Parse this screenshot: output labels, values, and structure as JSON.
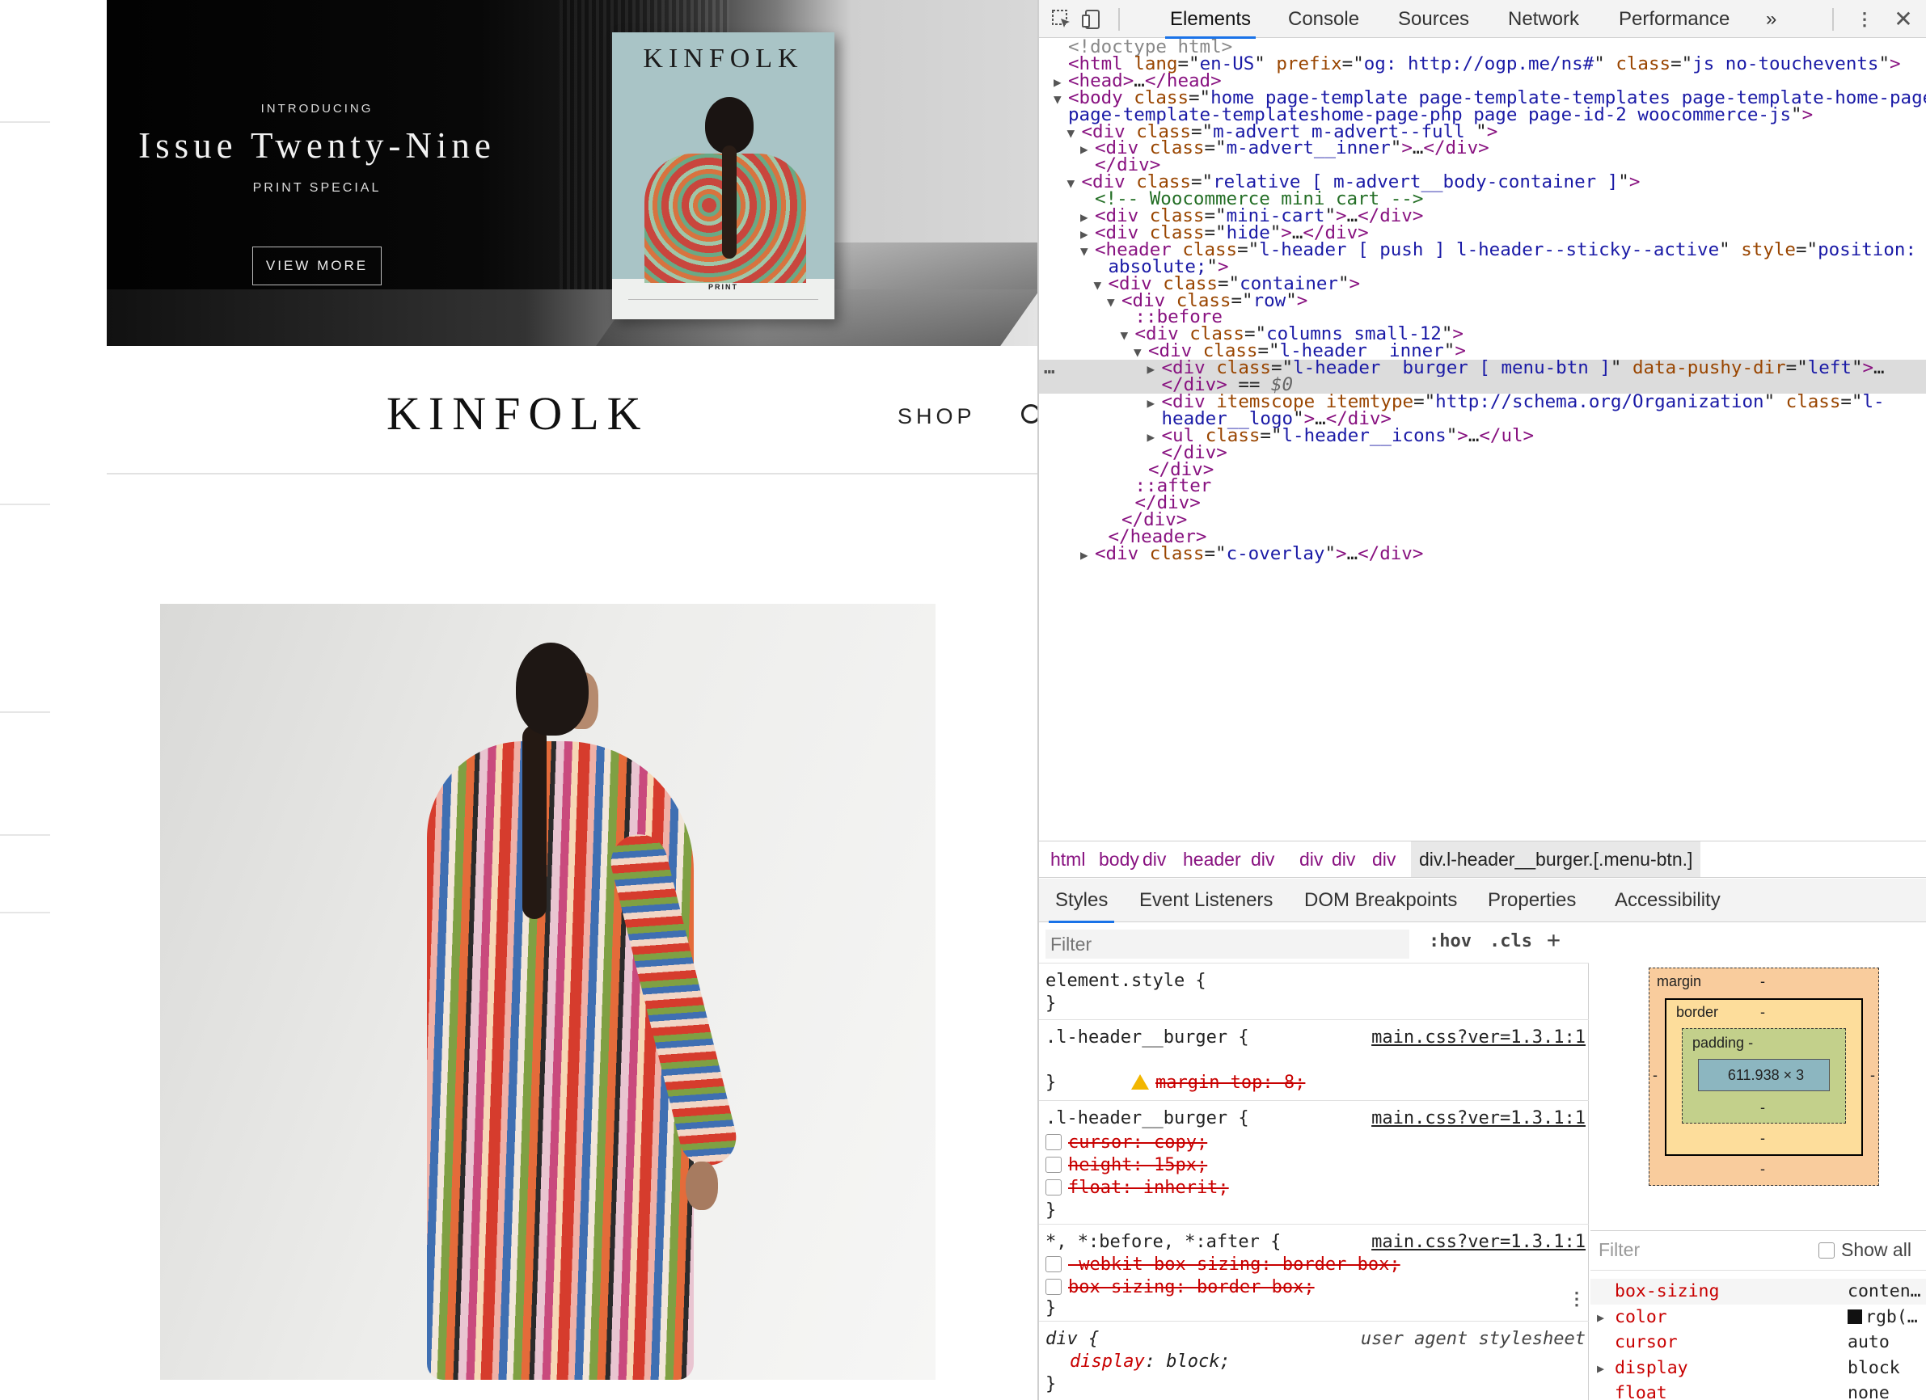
{
  "site": {
    "advert": {
      "intro": "INTRODUCING",
      "title": "Issue Twenty-Nine",
      "subtitle": "PRINT SPECIAL",
      "button": "VIEW MORE",
      "magazine_name": "KINFOLK",
      "magazine_label": "PRINT"
    },
    "header": {
      "logo": "KINFOLK",
      "shop": "SHOP"
    }
  },
  "devtools": {
    "tabs": [
      "Elements",
      "Console",
      "Sources",
      "Network",
      "Performance"
    ],
    "more_tabs": "»",
    "dom_lines": [
      {
        "indent": 0,
        "tri": "",
        "html": "<span class='dc'>&lt;!doctype html&gt;</span>"
      },
      {
        "indent": 0,
        "tri": "",
        "html": "<span class='tg'>&lt;html</span> <span class='an'>lang</span>=\"<span class='av'>en-US</span>\" <span class='an'>prefix</span>=\"<span class='av'>og: http://ogp.me/ns#</span>\" <span class='an'>class</span>=\"<span class='av'>js no-touchevents</span>\"<span class='tg'>&gt;</span>"
      },
      {
        "indent": 0,
        "tri": "▶",
        "html": "<span class='tg'>&lt;head&gt;</span>…<span class='tg'>&lt;/head&gt;</span>"
      },
      {
        "indent": 0,
        "tri": "▼",
        "html": "<span class='tg'>&lt;body</span> <span class='an'>class</span>=\"<span class='av'>home page-template page-template-templates page-template-home-page</span>"
      },
      {
        "indent": 0,
        "tri": "",
        "html": "<span class='av'>page-template-templateshome-page-php page page-id-2 woocommerce-js</span>\"<span class='tg'>&gt;</span>"
      },
      {
        "indent": 1,
        "tri": "▼",
        "html": "<span class='tg'>&lt;div</span> <span class='an'>class</span>=\"<span class='av'>m-advert m-advert--full </span>\"<span class='tg'>&gt;</span>"
      },
      {
        "indent": 2,
        "tri": "▶",
        "html": "<span class='tg'>&lt;div</span> <span class='an'>class</span>=\"<span class='av'>m-advert__inner</span>\"<span class='tg'>&gt;</span>…<span class='tg'>&lt;/div&gt;</span>"
      },
      {
        "indent": 2,
        "tri": "",
        "html": "<span class='tg'>&lt;/div&gt;</span>"
      },
      {
        "indent": 1,
        "tri": "▼",
        "html": "<span class='tg'>&lt;div</span> <span class='an'>class</span>=\"<span class='av'>relative [ m-advert__body-container ]</span>\"<span class='tg'>&gt;</span>"
      },
      {
        "indent": 2,
        "tri": "",
        "html": "<span class='cm'>&lt;!-- Woocommerce mini cart --&gt;</span>"
      },
      {
        "indent": 2,
        "tri": "▶",
        "html": "<span class='tg'>&lt;div</span> <span class='an'>class</span>=\"<span class='av'>mini-cart</span>\"<span class='tg'>&gt;</span>…<span class='tg'>&lt;/div&gt;</span>"
      },
      {
        "indent": 2,
        "tri": "▶",
        "html": "<span class='tg'>&lt;div</span> <span class='an'>class</span>=\"<span class='av'>hide</span>\"<span class='tg'>&gt;</span>…<span class='tg'>&lt;/div&gt;</span>"
      },
      {
        "indent": 2,
        "tri": "▼",
        "html": "<span class='tg'>&lt;header</span> <span class='an'>class</span>=\"<span class='av'>l-header [ push ] l-header--sticky--active</span>\" <span class='an'>style</span>=\"<span class='av'>position:</span>"
      },
      {
        "indent": 3,
        "tri": "",
        "html": "<span class='av'>absolute;</span>\"<span class='tg'>&gt;</span>"
      },
      {
        "indent": 3,
        "tri": "▼",
        "html": "<span class='tg'>&lt;div</span> <span class='an'>class</span>=\"<span class='av'>container</span>\"<span class='tg'>&gt;</span>"
      },
      {
        "indent": 4,
        "tri": "▼",
        "html": "<span class='tg'>&lt;div</span> <span class='an'>class</span>=\"<span class='av'>row</span>\"<span class='tg'>&gt;</span>"
      },
      {
        "indent": 5,
        "tri": "",
        "html": "<span class='pe'>::before</span>"
      },
      {
        "indent": 5,
        "tri": "▼",
        "html": "<span class='tg'>&lt;div</span> <span class='an'>class</span>=\"<span class='av'>columns small-12</span>\"<span class='tg'>&gt;</span>"
      },
      {
        "indent": 6,
        "tri": "▼",
        "html": "<span class='tg'>&lt;div</span> <span class='an'>class</span>=\"<span class='av'>l-header__inner</span>\"<span class='tg'>&gt;</span>"
      },
      {
        "indent": 7,
        "tri": "▶",
        "sel": true,
        "html": "<span class='tg'>&lt;div</span> <span class='an'>class</span>=\"<span class='av'>l-header__burger [ menu-btn ]</span>\" <span class='an'>data-pushy-dir</span>=\"<span class='av'>left</span>\"<span class='tg'>&gt;</span>…"
      },
      {
        "indent": 7,
        "tri": "",
        "sel": true,
        "html": "<span class='tg'>&lt;/div&gt;</span> == <i style='color:#666'>$0</i>"
      },
      {
        "indent": 7,
        "tri": "▶",
        "html": "<span class='tg'>&lt;div</span> <span class='an'>itemscope</span> <span class='an'>itemtype</span>=\"<span class='av'>http://schema.org/Organization</span>\" <span class='an'>class</span>=\"<span class='av'>l-</span>"
      },
      {
        "indent": 7,
        "tri": "",
        "html": "<span class='av'>header__logo</span>\"<span class='tg'>&gt;</span>…<span class='tg'>&lt;/div&gt;</span>"
      },
      {
        "indent": 7,
        "tri": "▶",
        "html": "<span class='tg'>&lt;ul</span> <span class='an'>class</span>=\"<span class='av'>l-header__icons</span>\"<span class='tg'>&gt;</span>…<span class='tg'>&lt;/ul&gt;</span>"
      },
      {
        "indent": 7,
        "tri": "",
        "html": "<span class='tg'>&lt;/div&gt;</span>"
      },
      {
        "indent": 6,
        "tri": "",
        "html": "<span class='tg'>&lt;/div&gt;</span>"
      },
      {
        "indent": 5,
        "tri": "",
        "html": "<span class='pe'>::after</span>"
      },
      {
        "indent": 5,
        "tri": "",
        "html": "<span class='tg'>&lt;/div&gt;</span>"
      },
      {
        "indent": 4,
        "tri": "",
        "html": "<span class='tg'>&lt;/div&gt;</span>"
      },
      {
        "indent": 3,
        "tri": "",
        "html": "<span class='tg'>&lt;/header&gt;</span>"
      },
      {
        "indent": 2,
        "tri": "▶",
        "html": "<span class='tg'>&lt;div</span> <span class='an'>class</span>=\"<span class='av'>c-overlay</span>\"<span class='tg'>&gt;</span>…<span class='tg'>&lt;/div&gt;</span>"
      }
    ],
    "selected_ellipsis": "…",
    "breadcrumbs": [
      "html",
      "body",
      "div",
      "header",
      "div",
      "div",
      "div",
      "div",
      "div.l-header__burger.[.menu-btn.]"
    ],
    "subtabs": [
      "Styles",
      "Event Listeners",
      "DOM Breakpoints",
      "Properties",
      "Accessibility"
    ],
    "styles": {
      "filter_placeholder": "Filter",
      "hov": ":hov",
      "cls": ".cls",
      "add": "+",
      "element_style": "element.style {",
      "close_brace": "}",
      "rule1_selector": ".l-header__burger {",
      "rule1_source": "main.css?ver=1.3.1:1",
      "rule1_prop": "margin-top: 8;",
      "rule2_selector": ".l-header__burger {",
      "rule2_source": "main.css?ver=1.3.1:1",
      "rule2_props": [
        "cursor: copy;",
        "height: 15px;",
        "float: inherit;"
      ],
      "rule3_selector": "*, *:before, *:after {",
      "rule3_source": "main.css?ver=1.3.1:1",
      "rule3_props": [
        "-webkit-box-sizing: border-box;",
        "box-sizing: border-box;"
      ],
      "rule4_selector": "div {",
      "rule4_source": "user agent stylesheet",
      "rule4_prop_name": "display",
      "rule4_prop_value": ": block;"
    },
    "boxmodel": {
      "margin_label": "margin",
      "border_label": "border",
      "padding_label": "padding -",
      "content": "611.938 × 3",
      "dash": "-"
    },
    "computed": {
      "filter_placeholder": "Filter",
      "show_all": "Show all",
      "rows": [
        {
          "name": "box-sizing",
          "value": "conten…",
          "expand": ""
        },
        {
          "name": "color",
          "value": "rgb(…",
          "expand": "▶",
          "swatch": "#111111"
        },
        {
          "name": "cursor",
          "value": "auto",
          "expand": ""
        },
        {
          "name": "display",
          "value": "block",
          "expand": "▶"
        },
        {
          "name": "float",
          "value": "none",
          "expand": ""
        }
      ]
    }
  }
}
